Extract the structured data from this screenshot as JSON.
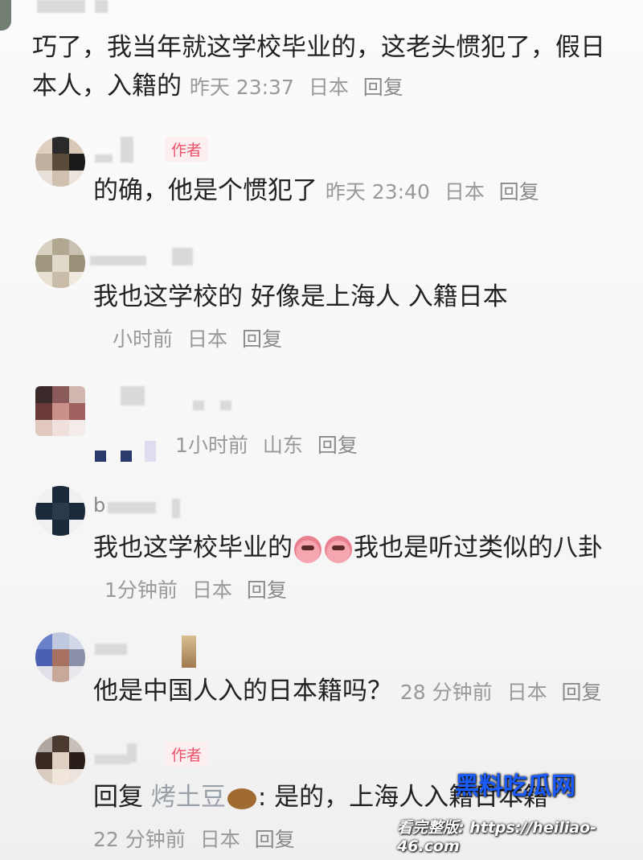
{
  "comments": [
    {
      "text_line1": "巧了，我当年就这学校毕业的，这老头惯犯了，假日",
      "text_line2": "本人，入籍的",
      "time": "昨天 23:37",
      "location": "日本",
      "reply": "回复"
    },
    {
      "tag": "作者",
      "text": "的确，他是个惯犯了",
      "time": "昨天 23:40",
      "location": "日本",
      "reply": "回复"
    },
    {
      "text": "我也这学校的 好像是上海人 入籍日本",
      "time": "小时前",
      "location": "日本",
      "reply": "回复"
    },
    {
      "time": "1小时前",
      "location": "山东",
      "reply": "回复"
    },
    {
      "name_partial": "b",
      "text_a": "我也这学校毕业的",
      "text_b": "我也是听过类似的八卦",
      "emoji_icon": "crying-face-icon",
      "time": "1分钟前",
      "location": "日本",
      "reply": "回复"
    },
    {
      "text": "他是中国人入的日本籍吗？",
      "time": "28 分钟前",
      "location": "日本",
      "reply": "回复"
    },
    {
      "tag": "作者",
      "reply_prefix": "回复",
      "mention": "烤土豆",
      "mention_icon": "potato-icon",
      "text": ": 是的，上海人入籍日本籍",
      "time": "22 分钟前",
      "location": "日本",
      "reply": "回复"
    }
  ],
  "watermark": {
    "brand": "黑料吃瓜网",
    "url": "看完整版: https://heiliao-46.com",
    "brand_color": "#1a5cff"
  }
}
